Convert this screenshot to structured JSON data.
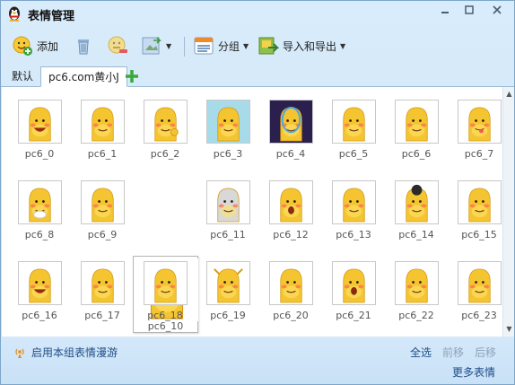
{
  "window": {
    "title": "表情管理"
  },
  "toolbar": {
    "add_label": "添加",
    "group_label": "分组",
    "import_export_label": "导入和导出"
  },
  "tabs": [
    {
      "label": "默认"
    },
    {
      "label": "pc6.com黄小J"
    }
  ],
  "emoticons": [
    {
      "label": "pc6_0"
    },
    {
      "label": "pc6_1"
    },
    {
      "label": "pc6_2"
    },
    {
      "label": "pc6_3"
    },
    {
      "label": "pc6_4"
    },
    {
      "label": "pc6_5"
    },
    {
      "label": "pc6_6"
    },
    {
      "label": "pc6_7"
    },
    {
      "label": "pc6_8"
    },
    {
      "label": "pc6_9"
    },
    {
      "label": "pc6_10"
    },
    {
      "label": "pc6_11"
    },
    {
      "label": "pc6_12"
    },
    {
      "label": "pc6_13"
    },
    {
      "label": "pc6_14"
    },
    {
      "label": "pc6_15"
    },
    {
      "label": "pc6_16"
    },
    {
      "label": "pc6_17"
    },
    {
      "label": "pc6_18"
    },
    {
      "label": "pc6_19"
    },
    {
      "label": "pc6_20"
    },
    {
      "label": "pc6_21"
    },
    {
      "label": "pc6_22"
    },
    {
      "label": "pc6_23"
    }
  ],
  "footer": {
    "roam_label": "启用本组表情漫游",
    "select_all": "全选",
    "move_forward": "前移",
    "move_back": "后移",
    "more": "更多表情"
  },
  "colors": {
    "link": "#1e4d86",
    "disabled": "#8fa3b8",
    "bean": "#f5c531",
    "bean_dark": "#e9a722",
    "cheek": "#ff6a4d"
  }
}
